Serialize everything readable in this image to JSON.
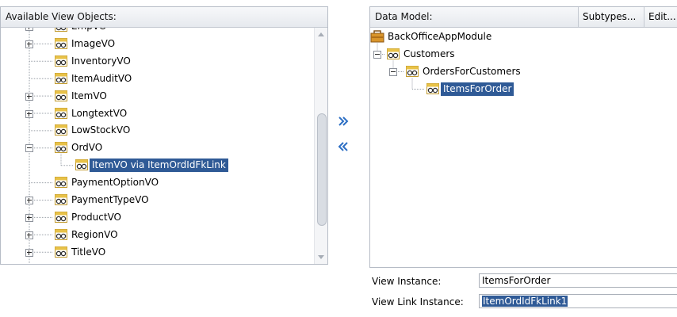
{
  "available": {
    "title": "Available View Objects:",
    "items": [
      {
        "label": "EmpVO",
        "expander": "plus",
        "selected": false
      },
      {
        "label": "ImageVO",
        "expander": "plus",
        "selected": false
      },
      {
        "label": "InventoryVO",
        "expander": "none",
        "selected": false
      },
      {
        "label": "ItemAuditVO",
        "expander": "none",
        "selected": false
      },
      {
        "label": "ItemVO",
        "expander": "plus",
        "selected": false
      },
      {
        "label": "LongtextVO",
        "expander": "plus",
        "selected": false
      },
      {
        "label": "LowStockVO",
        "expander": "none",
        "selected": false
      },
      {
        "label": "OrdVO",
        "expander": "minus",
        "selected": false
      },
      {
        "label": "ItemVO via ItemOrdIdFkLink",
        "expander": "none",
        "selected": true,
        "child": true
      },
      {
        "label": "PaymentOptionVO",
        "expander": "none",
        "selected": false
      },
      {
        "label": "PaymentTypeVO",
        "expander": "plus",
        "selected": false
      },
      {
        "label": "ProductVO",
        "expander": "plus",
        "selected": false
      },
      {
        "label": "RegionVO",
        "expander": "plus",
        "selected": false
      },
      {
        "label": "TitleVO",
        "expander": "plus",
        "selected": false
      }
    ]
  },
  "shuttle": {
    "add_icon": "double-chevron-right-icon",
    "remove_icon": "double-chevron-left-icon",
    "color": "#2d6fc4"
  },
  "model": {
    "title": "Data Model:",
    "subtypes_button": "Subtypes...",
    "edit_button": "Edit...",
    "tree": [
      {
        "label": "BackOfficeAppModule",
        "icon": "application-module-icon",
        "level": 0,
        "selected": false
      },
      {
        "label": "Customers",
        "icon": "view-object-icon",
        "level": 1,
        "selected": false
      },
      {
        "label": "OrdersForCustomers",
        "icon": "view-object-icon",
        "level": 2,
        "selected": false
      },
      {
        "label": "ItemsForOrder",
        "icon": "view-object-icon",
        "level": 3,
        "selected": true
      }
    ]
  },
  "fields": {
    "view_instance_label": "View Instance:",
    "view_instance_value": "ItemsForOrder",
    "view_link_instance_label": "View Link Instance:",
    "view_link_instance_value": "ItemOrdIdFkLink1"
  },
  "colors": {
    "selection": "#2f5a96",
    "border": "#b6bcc6"
  }
}
